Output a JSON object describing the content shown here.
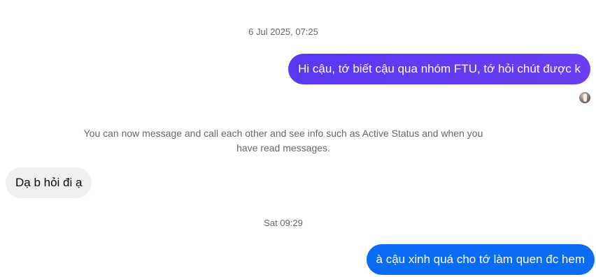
{
  "conversation": {
    "timestamps": {
      "first": "6 Jul 2025, 07:25",
      "second": "Sat 09:29"
    },
    "messages": [
      {
        "direction": "outgoing",
        "text": "Hi cậu, tớ biết cậu qua nhóm FTU, tớ hỏi chút được k",
        "color": "#5b3cf0"
      },
      {
        "direction": "incoming",
        "text": "Dạ b hỏi đi ạ",
        "color": "#f0f0f0"
      },
      {
        "direction": "outgoing",
        "text": "à cậu xinh quá cho tớ làm quen đc hem",
        "color": "#0a6cf5"
      }
    ],
    "system_notice": "You can now message and call each other and see info such as Active Status and when you have read messages.",
    "seen_indicator_icon": "avatar"
  }
}
